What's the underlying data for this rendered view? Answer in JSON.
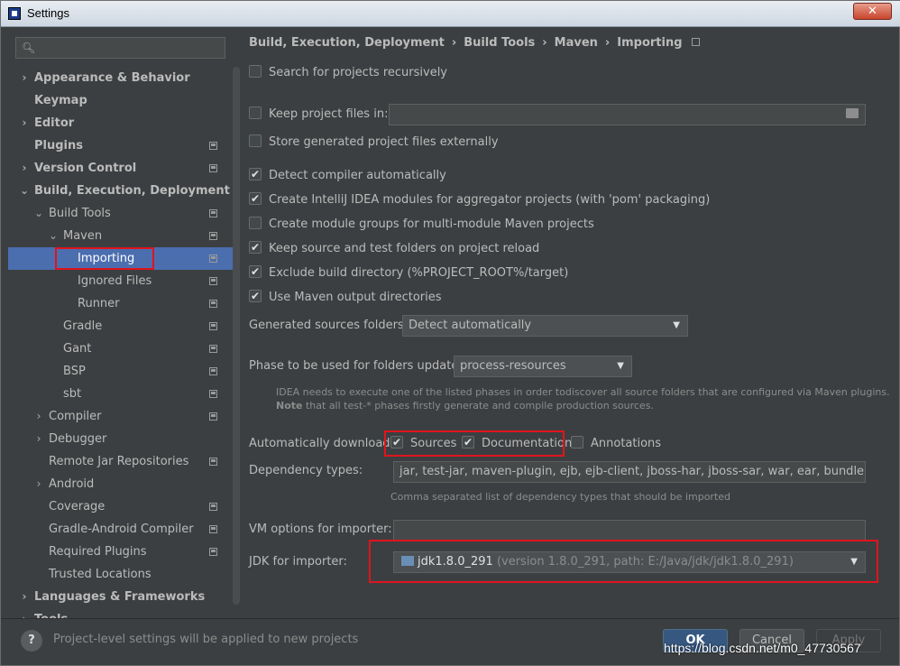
{
  "window": {
    "title": "Settings"
  },
  "search": {
    "placeholder": ""
  },
  "sidebar": {
    "items": [
      {
        "label": "Appearance & Behavior",
        "arrow": "›"
      },
      {
        "label": "Keymap",
        "arrow": ""
      },
      {
        "label": "Editor",
        "arrow": "›"
      },
      {
        "label": "Plugins",
        "arrow": ""
      },
      {
        "label": "Version Control",
        "arrow": "›"
      },
      {
        "label": "Build, Execution, Deployment",
        "arrow": "⌄"
      },
      {
        "label": "Build Tools",
        "arrow": "⌄"
      },
      {
        "label": "Maven",
        "arrow": "⌄"
      },
      {
        "label": "Importing",
        "arrow": ""
      },
      {
        "label": "Ignored Files",
        "arrow": ""
      },
      {
        "label": "Runner",
        "arrow": ""
      },
      {
        "label": "Gradle",
        "arrow": ""
      },
      {
        "label": "Gant",
        "arrow": ""
      },
      {
        "label": "BSP",
        "arrow": ""
      },
      {
        "label": "sbt",
        "arrow": ""
      },
      {
        "label": "Compiler",
        "arrow": "›"
      },
      {
        "label": "Debugger",
        "arrow": "›"
      },
      {
        "label": "Remote Jar Repositories",
        "arrow": ""
      },
      {
        "label": "Android",
        "arrow": "›"
      },
      {
        "label": "Coverage",
        "arrow": ""
      },
      {
        "label": "Gradle-Android Compiler",
        "arrow": ""
      },
      {
        "label": "Required Plugins",
        "arrow": ""
      },
      {
        "label": "Trusted Locations",
        "arrow": ""
      },
      {
        "label": "Languages & Frameworks",
        "arrow": "›"
      },
      {
        "label": "Tools",
        "arrow": "›"
      }
    ]
  },
  "breadcrumb": {
    "items": [
      "Build, Execution, Deployment",
      "Build Tools",
      "Maven",
      "Importing"
    ],
    "separator": "›"
  },
  "options": {
    "search_recursively": {
      "label": "Search for projects recursively",
      "checked": false
    },
    "keep_project_files": {
      "label": "Keep project files in:",
      "checked": false,
      "value": ""
    },
    "store_externally": {
      "label": "Store generated project files externally",
      "checked": false
    },
    "detect_compiler": {
      "label": "Detect compiler automatically",
      "checked": true
    },
    "create_modules": {
      "label": "Create IntelliJ IDEA modules for aggregator projects (with 'pom' packaging)",
      "checked": true
    },
    "create_groups": {
      "label": "Create module groups for multi-module Maven projects",
      "checked": false
    },
    "keep_source": {
      "label": "Keep source and test folders on project reload",
      "checked": true
    },
    "exclude_build": {
      "label": "Exclude build directory (%PROJECT_ROOT%/target)",
      "checked": true
    },
    "use_output": {
      "label": "Use Maven output directories",
      "checked": true
    }
  },
  "generated_sources": {
    "label": "Generated sources folders:",
    "value": "Detect automatically"
  },
  "phase": {
    "label": "Phase to be used for folders update:",
    "value": "process-resources",
    "hint_line1": "IDEA needs to execute one of the listed phases in order todiscover all source folders that are configured via Maven plugins.",
    "hint_note": "Note",
    "hint_line2": " that all test-* phases firstly generate and compile production sources."
  },
  "auto_download": {
    "label": "Automatically download:",
    "sources": {
      "label": "Sources",
      "checked": true
    },
    "documentation": {
      "label": "Documentation",
      "checked": true
    },
    "annotations": {
      "label": "Annotations",
      "checked": false
    }
  },
  "dependency_types": {
    "label": "Dependency types:",
    "value": "jar, test-jar, maven-plugin, ejb, ejb-client, jboss-har, jboss-sar, war, ear, bundle",
    "hint": "Comma separated list of dependency types that should be imported"
  },
  "vm_options": {
    "label": "VM options for importer:",
    "value": ""
  },
  "jdk": {
    "label": "JDK for importer:",
    "name": "jdk1.8.0_291",
    "detail": "(version 1.8.0_291, path: E:/Java/jdk/jdk1.8.0_291)"
  },
  "footer": {
    "help": "?",
    "message": "Project-level settings will be applied to new projects",
    "ok": "OK",
    "cancel": "Cancel",
    "apply": "Apply"
  },
  "watermark": "https://blog.csdn.net/m0_47730567",
  "colors": {
    "accent": "#4b6eaf",
    "highlight": "#e0141e",
    "background": "#3c3f41"
  }
}
